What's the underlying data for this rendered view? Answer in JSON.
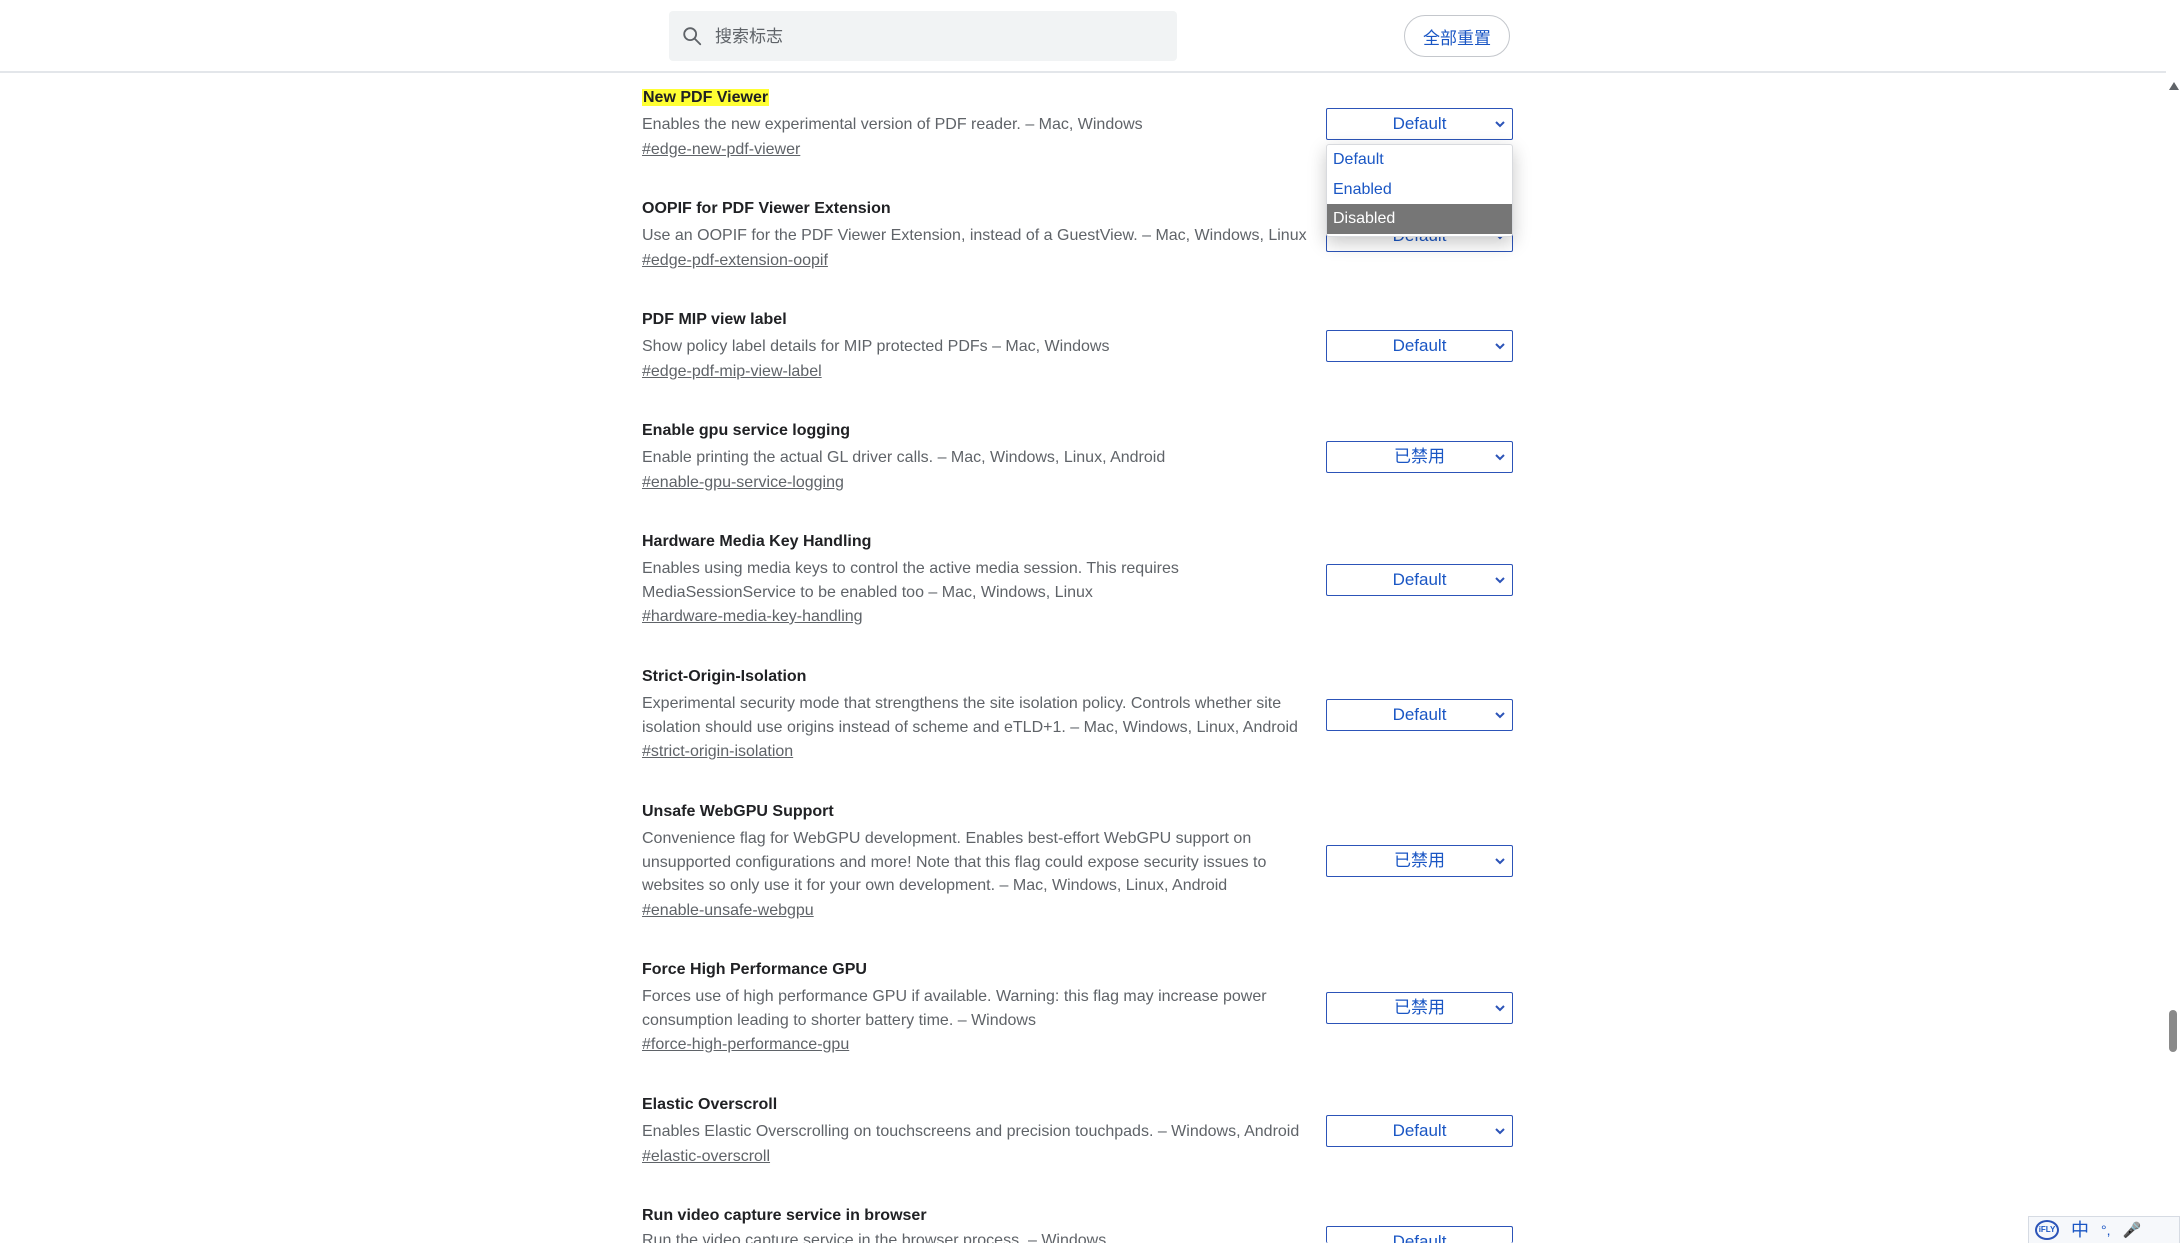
{
  "search": {
    "placeholder": "搜索标志"
  },
  "header": {
    "reset_label": "全部重置"
  },
  "flags": [
    {
      "title": "New PDF Viewer",
      "desc": "Enables the new experimental version of PDF reader. – Mac, Windows",
      "link": "#edge-new-pdf-viewer",
      "value": "Default"
    },
    {
      "title": "OOPIF for PDF Viewer Extension",
      "desc": "Use an OOPIF for the PDF Viewer Extension, instead of a GuestView. – Mac, Windows, Linux",
      "link": "#edge-pdf-extension-oopif",
      "value": "Default"
    },
    {
      "title": "PDF MIP view label",
      "desc": "Show policy label details for MIP protected PDFs – Mac, Windows",
      "link": "#edge-pdf-mip-view-label",
      "value": "Default"
    },
    {
      "title": "Enable gpu service logging",
      "desc": "Enable printing the actual GL driver calls. – Mac, Windows, Linux, Android",
      "link": "#enable-gpu-service-logging",
      "value": "已禁用"
    },
    {
      "title": "Hardware Media Key Handling",
      "desc": "Enables using media keys to control the active media session. This requires MediaSessionService to be enabled too – Mac, Windows, Linux",
      "link": "#hardware-media-key-handling",
      "value": "Default"
    },
    {
      "title": "Strict-Origin-Isolation",
      "desc": "Experimental security mode that strengthens the site isolation policy. Controls whether site isolation should use origins instead of scheme and eTLD+1. – Mac, Windows, Linux, Android",
      "link": "#strict-origin-isolation",
      "value": "Default"
    },
    {
      "title": "Unsafe WebGPU Support",
      "desc": "Convenience flag for WebGPU development. Enables best-effort WebGPU support on unsupported configurations and more! Note that this flag could expose security issues to websites so only use it for your own development. – Mac, Windows, Linux, Android",
      "link": "#enable-unsafe-webgpu",
      "value": "已禁用"
    },
    {
      "title": "Force High Performance GPU",
      "desc": "Forces use of high performance GPU if available. Warning: this flag may increase power consumption leading to shorter battery time. – Windows",
      "link": "#force-high-performance-gpu",
      "value": "已禁用"
    },
    {
      "title": "Elastic Overscroll",
      "desc": "Enables Elastic Overscrolling on touchscreens and precision touchpads. – Windows, Android",
      "link": "#elastic-overscroll",
      "value": "Default"
    },
    {
      "title": "Run video capture service in browser",
      "desc": "Run the video capture service in the browser process. – Windows",
      "link": "",
      "value": "Default"
    }
  ],
  "dropdown": {
    "options": [
      "Default",
      "Enabled",
      "Disabled"
    ],
    "highlighted": "Disabled"
  },
  "ime": {
    "logo": "iFLY",
    "lang": "中",
    "punct": "°,",
    "mic": "🎤"
  },
  "colors": {
    "accent": "#1a56c4",
    "highlight": "#ffff33",
    "border": "#2c54b8"
  }
}
